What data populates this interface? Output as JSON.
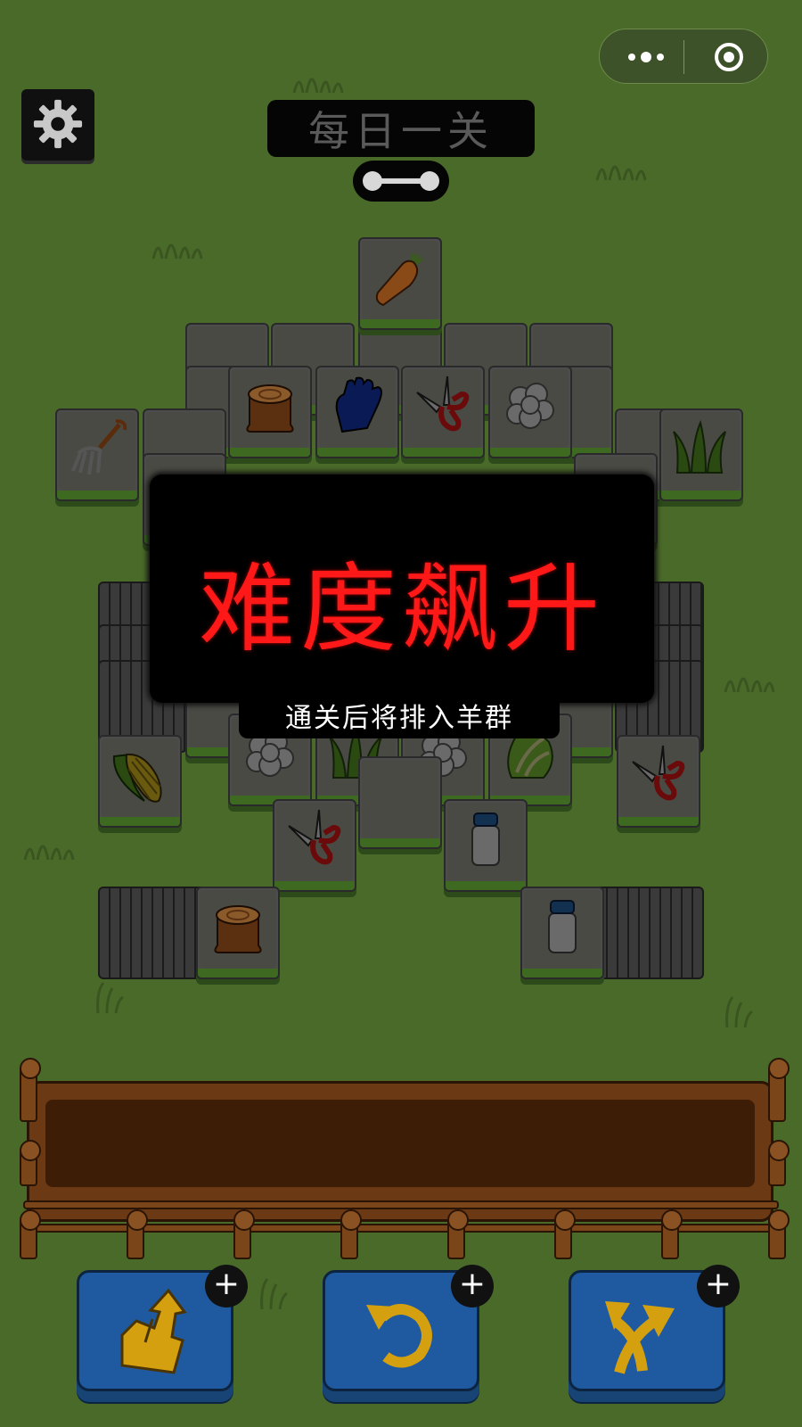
{
  "header": {
    "level_title": "每日一关"
  },
  "popup": {
    "title": "难度飙升",
    "subtitle": "通关后将排入羊群"
  },
  "icons": {
    "capsule_menu": "more-dots-icon",
    "capsule_close": "target-circle-icon",
    "settings": "gear-icon",
    "progress": "level-progress-icon"
  },
  "tiles": [
    "carrot",
    "stump",
    "glove",
    "shears",
    "cauliflower",
    "grass",
    "fork",
    "corn",
    "cauliflower",
    "grass",
    "cauliflower",
    "cabbage",
    "shears",
    "shears",
    "milk-can",
    "stump",
    "milk-can"
  ],
  "powerups": [
    {
      "name": "move-out",
      "icon": "move-out-icon"
    },
    {
      "name": "undo",
      "icon": "undo-icon"
    },
    {
      "name": "shuffle",
      "icon": "shuffle-icon"
    }
  ],
  "colors": {
    "background": "#4a6a2a",
    "popup_title": "#ff1818",
    "button_blue": "#1f5aa0",
    "tray_wood": "#6b3a14"
  }
}
